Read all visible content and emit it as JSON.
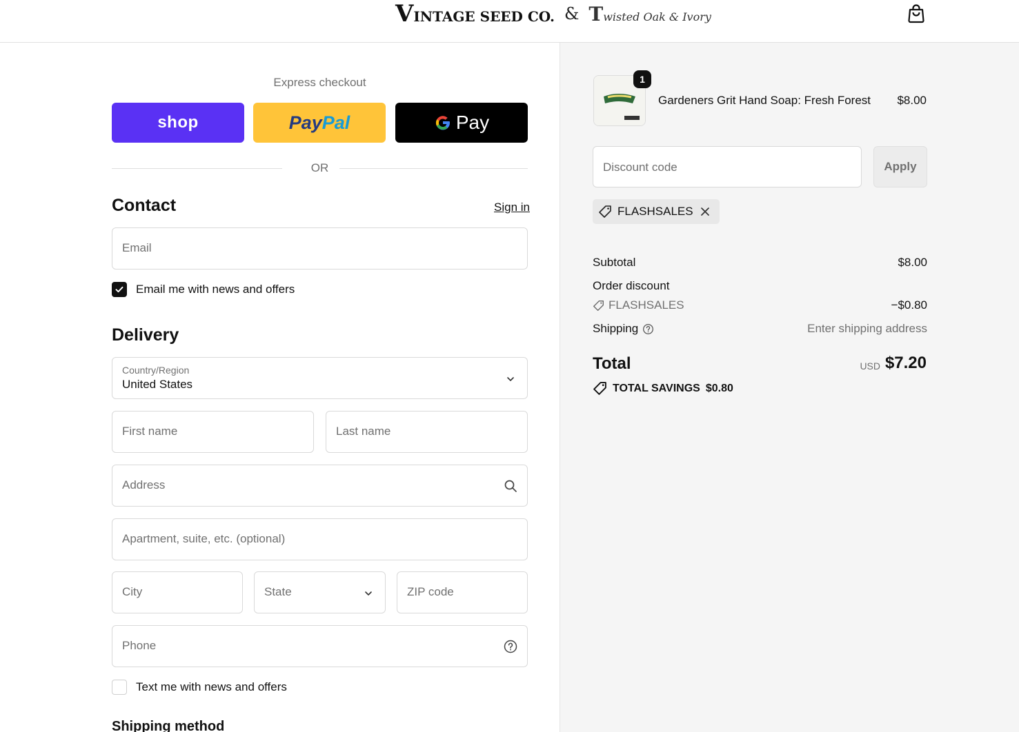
{
  "header": {
    "logo_primary_initial": "V",
    "logo_primary_rest": "INTAGE SEED CO.",
    "logo_amp": "&",
    "logo_secondary_initial": "T",
    "logo_secondary_rest": "wisted Oak & Ivory",
    "cart_icon": "shopping-bag-icon"
  },
  "express": {
    "title": "Express checkout",
    "shop_label": "shop",
    "paypal_part1": "Pay",
    "paypal_part2": "Pal",
    "gpay_label": "Pay",
    "or_label": "OR"
  },
  "contact": {
    "title": "Contact",
    "signin_label": "Sign in",
    "email_placeholder": "Email",
    "news_label": "Email me with news and offers",
    "news_checked": true
  },
  "delivery": {
    "title": "Delivery",
    "country_label": "Country/Region",
    "country_value": "United States",
    "first_name_placeholder": "First name",
    "last_name_placeholder": "Last name",
    "address_placeholder": "Address",
    "apartment_placeholder": "Apartment, suite, etc. (optional)",
    "city_placeholder": "City",
    "state_placeholder": "State",
    "zip_placeholder": "ZIP code",
    "phone_placeholder": "Phone",
    "sms_label": "Text me with news and offers",
    "sms_checked": false
  },
  "shipping_method": {
    "title": "Shipping method"
  },
  "summary": {
    "item": {
      "quantity": "1",
      "name": "Gardeners Grit Hand Soap: Fresh Forest",
      "price": "$8.00"
    },
    "discount_placeholder": "Discount code",
    "apply_label": "Apply",
    "applied_code": "FLASHSALES",
    "subtotal_label": "Subtotal",
    "subtotal_value": "$8.00",
    "order_discount_label": "Order discount",
    "discount_code_label": "FLASHSALES",
    "discount_value": "−$0.80",
    "shipping_label": "Shipping",
    "shipping_value": "Enter shipping address",
    "total_label": "Total",
    "total_currency": "USD",
    "total_value": "$7.20",
    "savings_label": "TOTAL SAVINGS",
    "savings_value": "$0.80"
  },
  "colors": {
    "shop_purple": "#5a31f4",
    "paypal_yellow": "#ffc439",
    "gpay_black": "#000000",
    "summary_bg": "#f5f5f5"
  }
}
